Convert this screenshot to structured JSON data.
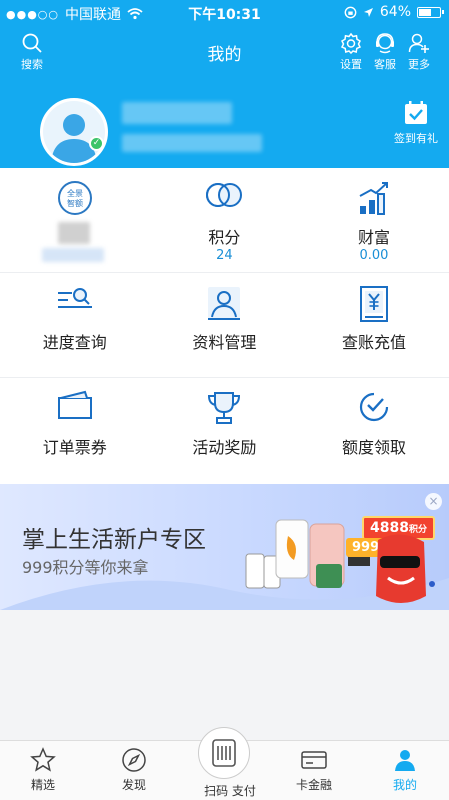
{
  "status_bar": {
    "carrier": "中国联通",
    "time": "下午10:31",
    "battery": "64%",
    "battery_level": 0.64
  },
  "header": {
    "title": "我的",
    "search_label": "搜索",
    "settings_label": "设置",
    "service_label": "客服",
    "more_label": "更多",
    "checkin_label": "签到有礼"
  },
  "grid": {
    "row1": [
      {
        "icon": "badge-icon",
        "badge_text_top": "全景",
        "badge_text_bottom": "智额"
      },
      {
        "label": "积分",
        "value": "24"
      },
      {
        "label": "财富",
        "value": "0.00"
      }
    ],
    "row2": [
      {
        "label": "进度查询"
      },
      {
        "label": "资料管理"
      },
      {
        "label": "查账充值"
      }
    ],
    "row3": [
      {
        "label": "订单票券"
      },
      {
        "label": "活动奖励"
      },
      {
        "label": "额度领取"
      }
    ]
  },
  "banner": {
    "title": "掌上生活新户专区",
    "subtitle": "999积分等你来拿",
    "tag_main": "4888",
    "tag_main_suffix": "积分",
    "tag_secondary": "999",
    "close": "×"
  },
  "tabbar": {
    "tab1": "精选",
    "tab2": "发现",
    "tab3": "扫码 支付",
    "tab4": "卡金融",
    "tab5": "我的"
  },
  "colors": {
    "brand_blue": "#14aaf0",
    "link_blue": "#1a8fd6"
  }
}
